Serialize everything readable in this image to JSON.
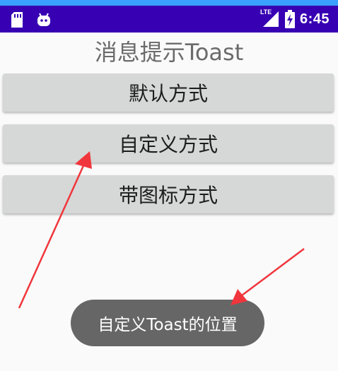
{
  "status_bar": {
    "time": "6:45",
    "network_label": "LTE",
    "icons": [
      "sd-card-icon",
      "android-icon",
      "lte-signal-icon",
      "battery-charging-icon"
    ],
    "colors": {
      "bar": "#3700b3",
      "top_strip": "#3aa0ff"
    }
  },
  "page": {
    "title": "消息提示Toast"
  },
  "buttons": [
    {
      "label": "默认方式"
    },
    {
      "label": "自定义方式"
    },
    {
      "label": "带图标方式"
    }
  ],
  "toast": {
    "text": "自定义Toast的位置"
  },
  "annotations": {
    "arrow_color": "#f0363c"
  }
}
